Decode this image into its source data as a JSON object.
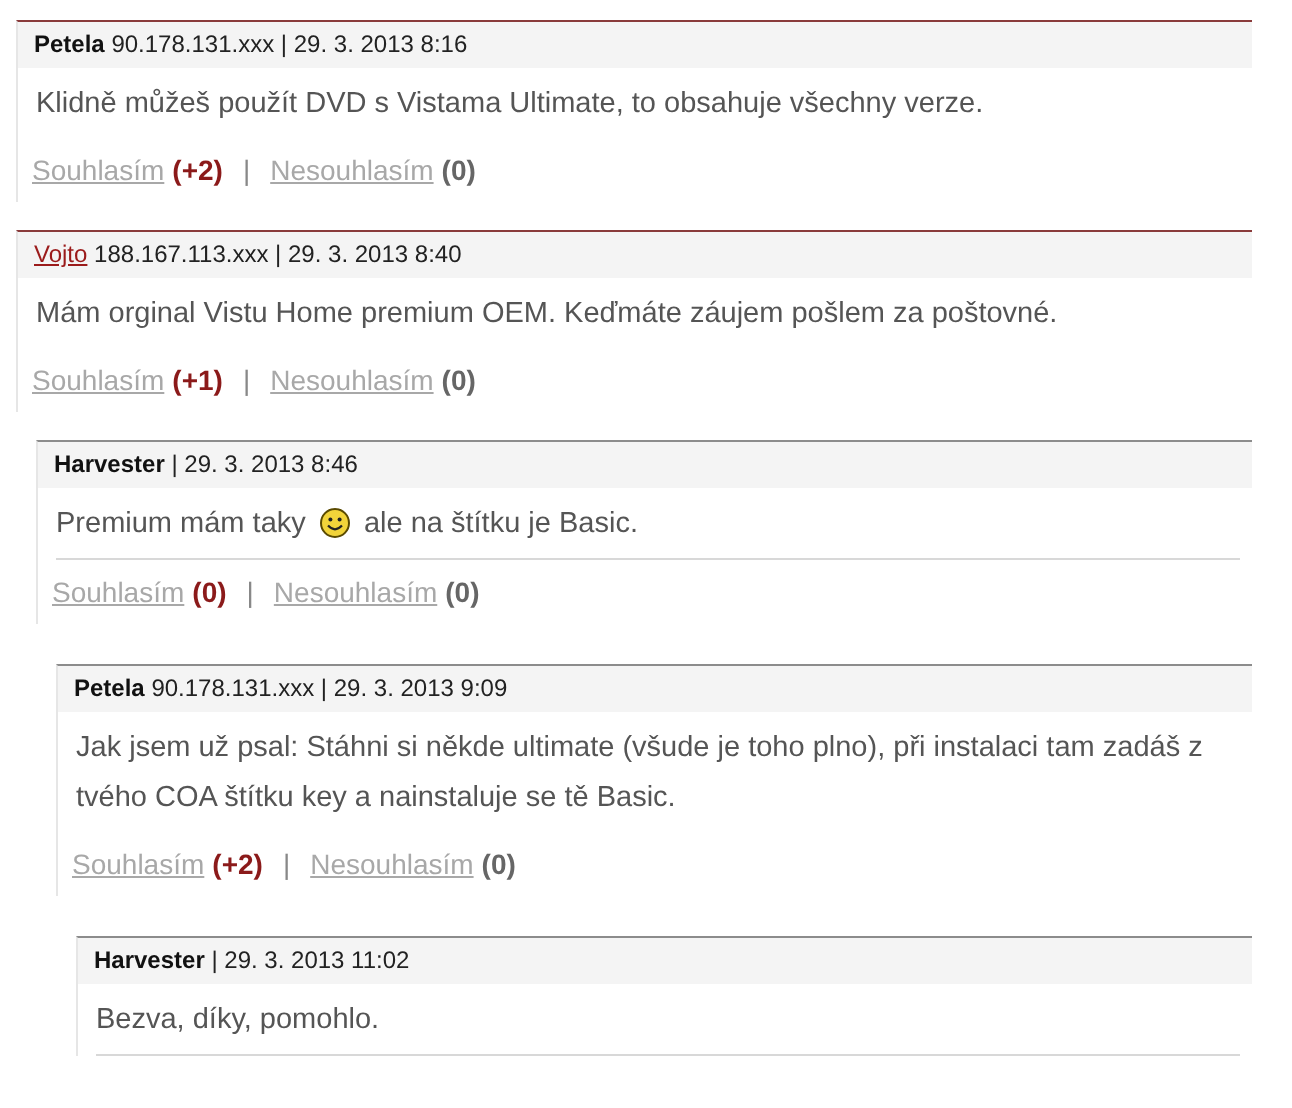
{
  "comments": [
    {
      "author": "Petela",
      "author_link": false,
      "meta": "90.178.131.xxx | 29. 3. 2013 8:16",
      "divider": false,
      "body": [
        {
          "kind": "text",
          "text": "Klidně můžeš použít DVD s Vistama Ultimate, to obsahuje všechny verze."
        }
      ],
      "votes": {
        "agree": "Souhlasím",
        "agree_count": "(+2)",
        "separator": "|",
        "disagree": "Nesouhlasím",
        "disagree_count": "(0)"
      }
    },
    {
      "author": "Vojto",
      "author_link": true,
      "meta": "188.167.113.xxx | 29. 3. 2013 8:40",
      "divider": false,
      "body": [
        {
          "kind": "text",
          "text": "Mám orginal Vistu Home premium OEM. Keďmáte záujem pošlem za poštovné."
        }
      ],
      "votes": {
        "agree": "Souhlasím",
        "agree_count": "(+1)",
        "separator": "|",
        "disagree": "Nesouhlasím",
        "disagree_count": "(0)"
      },
      "children": [
        {
          "author": "Harvester",
          "author_link": false,
          "meta": "| 29. 3. 2013 8:46",
          "divider": true,
          "body": [
            {
              "kind": "text",
              "text": "Premium mám taky"
            },
            {
              "kind": "smiley"
            },
            {
              "kind": "text",
              "text": "ale na štítku je Basic."
            }
          ],
          "votes": {
            "agree": "Souhlasím",
            "agree_count": "(0)",
            "separator": "|",
            "disagree": "Nesouhlasím",
            "disagree_count": "(0)"
          },
          "children": [
            {
              "author": "Petela",
              "author_link": false,
              "meta": "90.178.131.xxx | 29. 3. 2013 9:09",
              "divider": false,
              "body": [
                {
                  "kind": "text",
                  "text": "Jak jsem už psal: Stáhni si někde ultimate (všude je toho plno), při instalaci tam zadáš z tvého COA štítku key a nainstaluje se tě Basic."
                }
              ],
              "votes": {
                "agree": "Souhlasím",
                "agree_count": "(+2)",
                "separator": "|",
                "disagree": "Nesouhlasím",
                "disagree_count": "(0)"
              },
              "children": [
                {
                  "author": "Harvester",
                  "author_link": false,
                  "meta": "| 29. 3. 2013 11:02",
                  "divider": true,
                  "body": [
                    {
                      "kind": "text",
                      "text": "Bezva, díky, pomohlo."
                    }
                  ]
                }
              ]
            }
          ]
        }
      ]
    }
  ]
}
